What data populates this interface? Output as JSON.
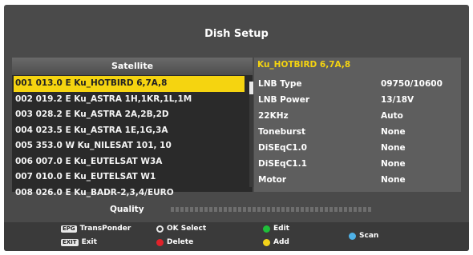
{
  "title": "Dish Setup",
  "satellite": {
    "header": "Satellite",
    "items": [
      "001 013.0 E  Ku_HOTBIRD 6,7A,8",
      "002 019.2 E  Ku_ASTRA 1H,1KR,1L,1M",
      "003 028.2 E  Ku_ASTRA 2A,2B,2D",
      "004 023.5 E  Ku_ASTRA 1E,1G,3A",
      "005 353.0 W  Ku_NILESAT 101, 10",
      "006 007.0 E  Ku_EUTELSAT W3A",
      "007 010.0 E  Ku_EUTELSAT W1",
      "008 026.0 E  Ku_BADR-2,3,4/EURO"
    ],
    "selected_index": 0
  },
  "detail": {
    "title": "Ku_HOTBIRD 6,7A,8",
    "rows": [
      {
        "label": "LNB Type",
        "value": "09750/10600"
      },
      {
        "label": "LNB Power",
        "value": "13/18V"
      },
      {
        "label": "22KHz",
        "value": "Auto"
      },
      {
        "label": "Toneburst",
        "value": "None"
      },
      {
        "label": "DiSEqC1.0",
        "value": "None"
      },
      {
        "label": "DiSEqC1.1",
        "value": "None"
      },
      {
        "label": "Motor",
        "value": "None"
      }
    ]
  },
  "quality": {
    "label": "Quality",
    "level": 0
  },
  "footer": {
    "epg_key": "EPG",
    "epg_label": "TransPonder",
    "exit_key": "EXIT",
    "exit_label": "Exit",
    "ok_label": "OK Select",
    "delete_label": "Delete",
    "edit_label": "Edit",
    "add_label": "Add",
    "scan_label": "Scan"
  },
  "colors": {
    "highlight": "#f5d410",
    "panel": "#4a4a4a",
    "green": "#1fbf3a",
    "red": "#e0222a",
    "yellow": "#f2d21a",
    "blue": "#4fb2e8"
  }
}
